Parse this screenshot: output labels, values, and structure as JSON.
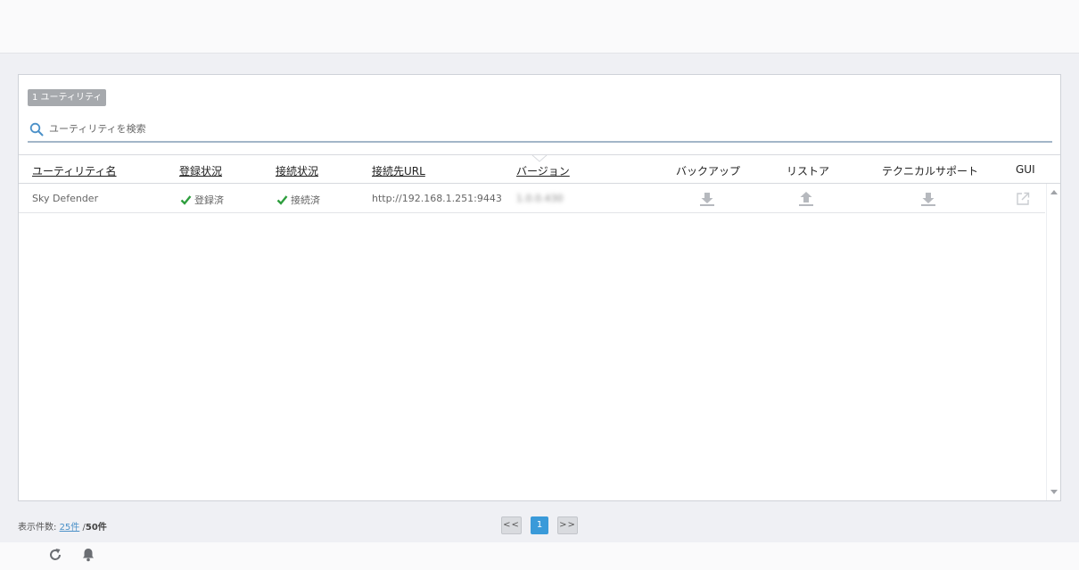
{
  "badge": {
    "count_label": "1 ユーティリティ"
  },
  "search": {
    "placeholder": "ユーティリティを検索"
  },
  "columns": {
    "name": "ユーティリティ名",
    "registration": "登録状況",
    "connection": "接続状況",
    "url": "接続先URL",
    "version": "バージョン",
    "backup": "バックアップ",
    "restore": "リストア",
    "support": "テクニカルサポート",
    "gui": "GUI"
  },
  "rows": [
    {
      "name": "Sky Defender",
      "registration": "登録済",
      "connection": "接続済",
      "url": "http://192.168.1.251:9443",
      "version": "1.0.0.430"
    }
  ],
  "footer": {
    "per_page_label": "表示件数:",
    "per_page_current": "25件",
    "separator": "/",
    "per_page_alt": "50件"
  },
  "pagination": {
    "prev": "<<",
    "current": "1",
    "next": ">>"
  },
  "colors": {
    "accent": "#3a9ad9",
    "check": "#2e9e3e",
    "link": "#4a90c8"
  },
  "icons": [
    "search-icon",
    "check-icon",
    "download-icon",
    "upload-icon",
    "external-link-icon",
    "refresh-icon",
    "bell-icon"
  ]
}
